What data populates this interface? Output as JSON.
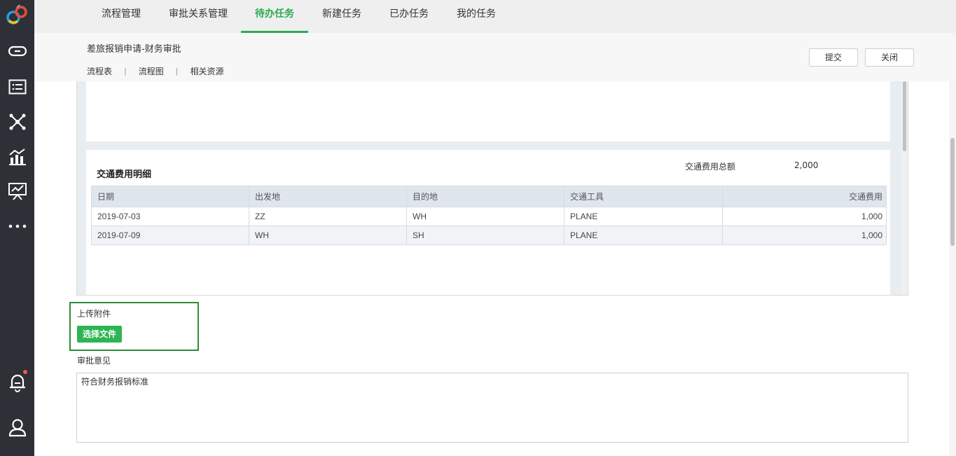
{
  "nav": {
    "tabs": [
      {
        "label": "流程管理"
      },
      {
        "label": "审批关系管理"
      },
      {
        "label": "待办任务"
      },
      {
        "label": "新建任务"
      },
      {
        "label": "已办任务"
      },
      {
        "label": "我的任务"
      }
    ],
    "active_tab": "待办任务"
  },
  "sidebar": {
    "icons": [
      "app-logo-icon",
      "link-icon",
      "list-card-icon",
      "network-icon",
      "chart-icon",
      "presentation-icon",
      "more-icon",
      "bell-icon",
      "user-icon"
    ]
  },
  "header": {
    "title": "差旅报销申请-财务审批",
    "links": [
      "流程表",
      "流程图",
      "相关资源"
    ],
    "separator": "|",
    "submit_label": "提交",
    "close_label": "关闭"
  },
  "transport": {
    "section_title": "交通费用明细",
    "total_label": "交通费用总额",
    "total_value": "2,000",
    "columns": [
      "日期",
      "出发地",
      "目的地",
      "交通工具",
      "交通费用"
    ],
    "rows": [
      [
        "2019-07-03",
        "ZZ",
        "WH",
        "PLANE",
        "1,000"
      ],
      [
        "2019-07-09",
        "WH",
        "SH",
        "PLANE",
        "1,000"
      ]
    ]
  },
  "upload": {
    "label": "上传附件",
    "button_label": "选择文件"
  },
  "opinion": {
    "label": "审批意见",
    "value": "符合财务报销标准"
  },
  "colors": {
    "accent": "#2eab52",
    "sidebar_bg": "#2d3036",
    "notification_dot": "#f05a4a"
  }
}
